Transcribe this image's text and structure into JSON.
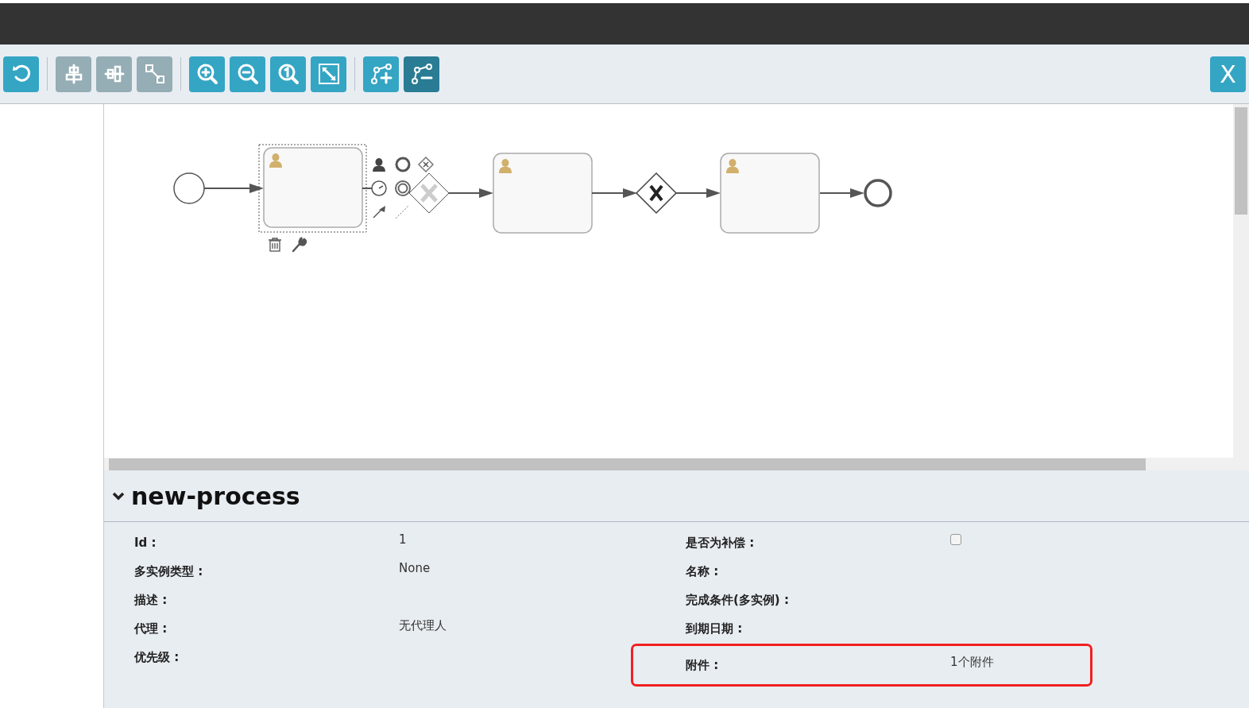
{
  "toolbar": {
    "groups": [
      [
        {
          "kind": "undo",
          "disabled": false,
          "selected": false
        }
      ],
      [
        {
          "kind": "align-horizontal",
          "disabled": true,
          "selected": false
        },
        {
          "kind": "align-vertical",
          "disabled": true,
          "selected": false
        },
        {
          "kind": "same-size",
          "disabled": true,
          "selected": false
        }
      ],
      [
        {
          "kind": "zoom-in",
          "disabled": false,
          "selected": false
        },
        {
          "kind": "zoom-out",
          "disabled": false,
          "selected": false
        },
        {
          "kind": "zoom-actual",
          "disabled": false,
          "selected": false
        },
        {
          "kind": "zoom-fit",
          "disabled": false,
          "selected": false
        }
      ],
      [
        {
          "kind": "add-bendpoint",
          "disabled": false,
          "selected": false
        },
        {
          "kind": "remove-bendpoint",
          "disabled": false,
          "selected": true
        }
      ]
    ],
    "close_label": "X"
  },
  "properties": {
    "title": "new-process",
    "expanded": true,
    "left": [
      {
        "label": "Id :",
        "value": "1",
        "highlighted": false
      },
      {
        "label": "多实例类型 :",
        "value": "None",
        "highlighted": false
      },
      {
        "label": "描述 :",
        "highlighted": false
      },
      {
        "label": "代理 :",
        "value": "无代理人",
        "highlighted": false
      },
      {
        "label": "优先级 :",
        "highlighted": false
      }
    ],
    "right": [
      {
        "label": "是否为补偿 :",
        "kind": "checkbox",
        "checked": false,
        "highlighted": false
      },
      {
        "label": "名称 :",
        "highlighted": false
      },
      {
        "label": "完成条件(多实例) :",
        "highlighted": false
      },
      {
        "label": "到期日期 :",
        "highlighted": false
      },
      {
        "label": "附件 :",
        "value": "1个附件",
        "highlighted": true
      }
    ]
  }
}
